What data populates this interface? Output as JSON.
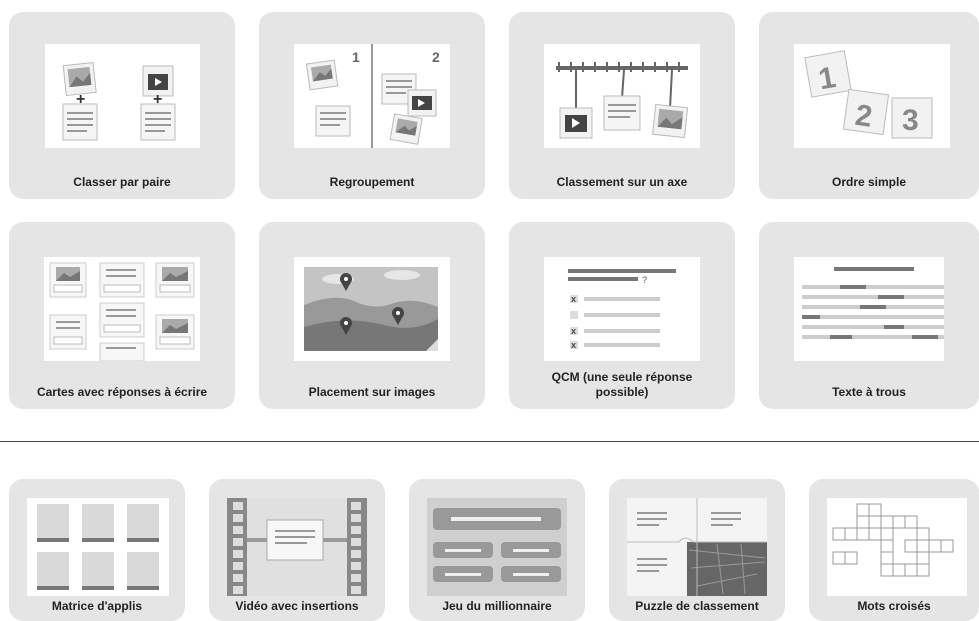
{
  "top_templates": [
    {
      "label": "Classer par paire",
      "icon": "pair-matching-icon"
    },
    {
      "label": "Regroupement",
      "icon": "grouping-icon"
    },
    {
      "label": "Classement sur un axe",
      "icon": "timeline-axis-icon"
    },
    {
      "label": "Ordre simple",
      "icon": "simple-order-icon"
    },
    {
      "label": "Cartes avec réponses à écrire",
      "icon": "write-answer-cards-icon"
    },
    {
      "label": "Placement sur images",
      "icon": "map-pins-icon"
    },
    {
      "label": "QCM (une seule réponse\npossible)",
      "icon": "multiple-choice-icon"
    },
    {
      "label": "Texte à trous",
      "icon": "fill-gaps-icon"
    }
  ],
  "bottom_templates": [
    {
      "label": "Matrice d'applis",
      "icon": "app-matrix-icon"
    },
    {
      "label": "Vidéo avec insertions",
      "icon": "video-insertions-icon"
    },
    {
      "label": "Jeu du millionnaire",
      "icon": "millionaire-game-icon"
    },
    {
      "label": "Puzzle de classement",
      "icon": "puzzle-icon"
    },
    {
      "label": "Mots croisés",
      "icon": "crossword-icon"
    }
  ],
  "order_numbers": [
    "1",
    "2",
    "3"
  ],
  "group_numbers": [
    "1",
    "2"
  ],
  "qcm_marks": [
    "x",
    "x",
    "x"
  ]
}
